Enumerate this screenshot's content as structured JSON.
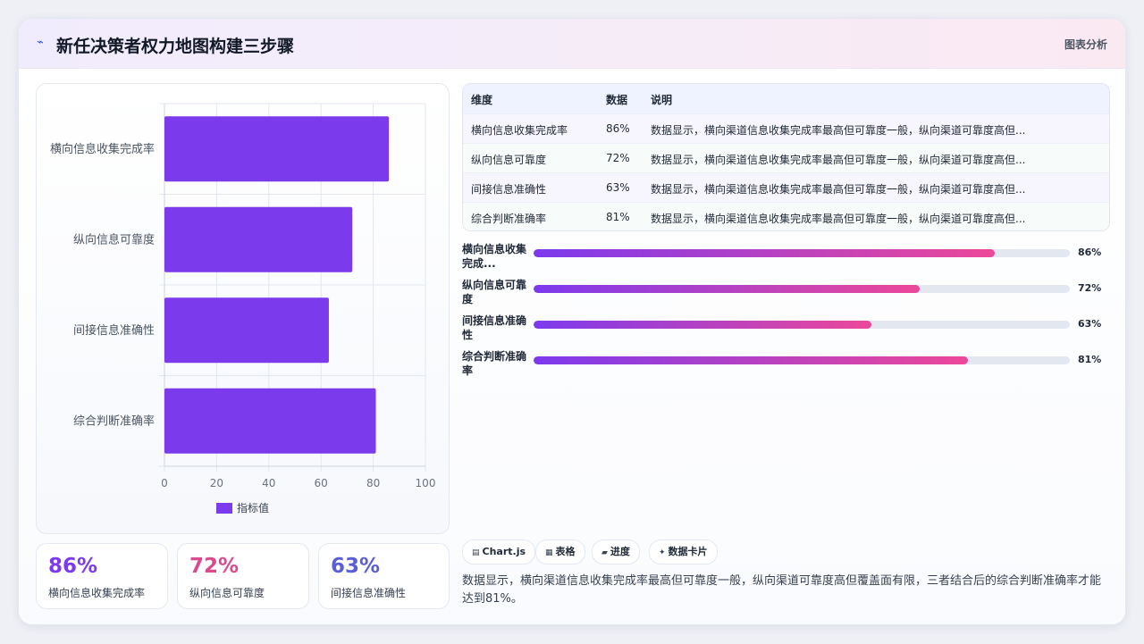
{
  "header": {
    "icon": "pulse-icon",
    "title": "新任决策者权力地图构建三步骤",
    "action": "图表分析"
  },
  "chart_data": {
    "type": "bar",
    "orientation": "horizontal",
    "categories": [
      "横向信息收集完成率",
      "纵向信息可靠度",
      "间接信息准确性",
      "综合判断准确率"
    ],
    "series": [
      {
        "name": "指标值",
        "values": [
          86,
          72,
          63,
          81
        ],
        "color": "#7c3aed"
      }
    ],
    "xlim": [
      0,
      100
    ],
    "xticks": [
      "0",
      "20",
      "40",
      "60",
      "80",
      "100"
    ],
    "grid": true,
    "legend": "bottom"
  },
  "table": {
    "headers": [
      "维度",
      "数据",
      "说明"
    ],
    "rows": [
      [
        "横向信息收集完成率",
        "86%",
        "数据显示，横向渠道信息收集完成率最高但可靠度一般，纵向渠道可靠度高但..."
      ],
      [
        "纵向信息可靠度",
        "72%",
        "数据显示，横向渠道信息收集完成率最高但可靠度一般，纵向渠道可靠度高但..."
      ],
      [
        "间接信息准确性",
        "63%",
        "数据显示，横向渠道信息收集完成率最高但可靠度一般，纵向渠道可靠度高但..."
      ],
      [
        "综合判断准确率",
        "81%",
        "数据显示，横向渠道信息收集完成率最高但可靠度一般，纵向渠道可靠度高但..."
      ]
    ]
  },
  "progress": [
    {
      "label": "横向信息收集完成...",
      "value": 86,
      "text": "86%"
    },
    {
      "label": "纵向信息可靠度",
      "value": 72,
      "text": "72%"
    },
    {
      "label": "间接信息准确性",
      "value": 63,
      "text": "63%"
    },
    {
      "label": "综合判断准确率",
      "value": 81,
      "text": "81%"
    }
  ],
  "stats": [
    {
      "value": "86%",
      "label": "横向信息收集完成率",
      "color": "#7c3aed"
    },
    {
      "value": "72%",
      "label": "纵向信息可靠度",
      "color": "#db4a8f"
    },
    {
      "value": "63%",
      "label": "间接信息准确性",
      "color": "#5b5fd6"
    }
  ],
  "chips": [
    {
      "icon": "chart-icon",
      "glyph": "▤",
      "label": "Chart.js"
    },
    {
      "icon": "table-icon",
      "glyph": "▦",
      "label": "表格"
    },
    {
      "icon": "progress-icon",
      "glyph": "▰",
      "label": "进度"
    },
    {
      "icon": "sparkle-icon",
      "glyph": "✦",
      "label": "数据卡片"
    }
  ],
  "summary": "数据显示，横向渠道信息收集完成率最高但可靠度一般，纵向渠道可靠度高但覆盖面有限，三者结合后的综合判断准确率才能达到81%。"
}
